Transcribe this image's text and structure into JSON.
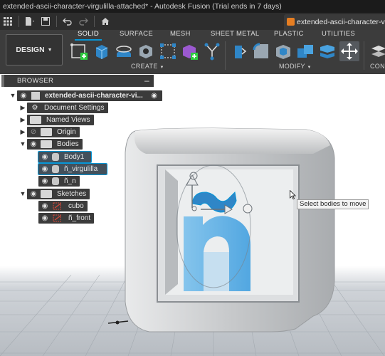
{
  "window": {
    "title": "extended-ascii-character-virgulilla-attached* - Autodesk Fusion (Trial ends in 7 days)",
    "document_tab": "extended-ascii-character-virgulilla"
  },
  "ribbon": {
    "workspace": "DESIGN",
    "tabs": [
      "SOLID",
      "SURFACE",
      "MESH",
      "SHEET METAL",
      "PLASTIC",
      "UTILITIES"
    ],
    "active_tab": "SOLID",
    "groups": {
      "create": "CREATE",
      "modify": "MODIFY",
      "construct_partial": "CONF"
    }
  },
  "browser": {
    "title": "BROWSER",
    "root": "extended-ascii-character-vi...",
    "items": {
      "document_settings": "Document Settings",
      "named_views": "Named Views",
      "origin": "Origin",
      "bodies": "Bodies",
      "body1": "Body1",
      "virgulilla": "ñ_virgulilla",
      "n": "ñ_n",
      "sketches": "Sketches",
      "cubo": "cubo",
      "front": "ñ_front"
    }
  },
  "tooltip": "Select bodies to move",
  "colors": {
    "accent": "#0696d7",
    "chrome_dark": "#2d2d2d",
    "ribbon": "#3c3c3c",
    "body_blue": "#4aa3e0"
  }
}
